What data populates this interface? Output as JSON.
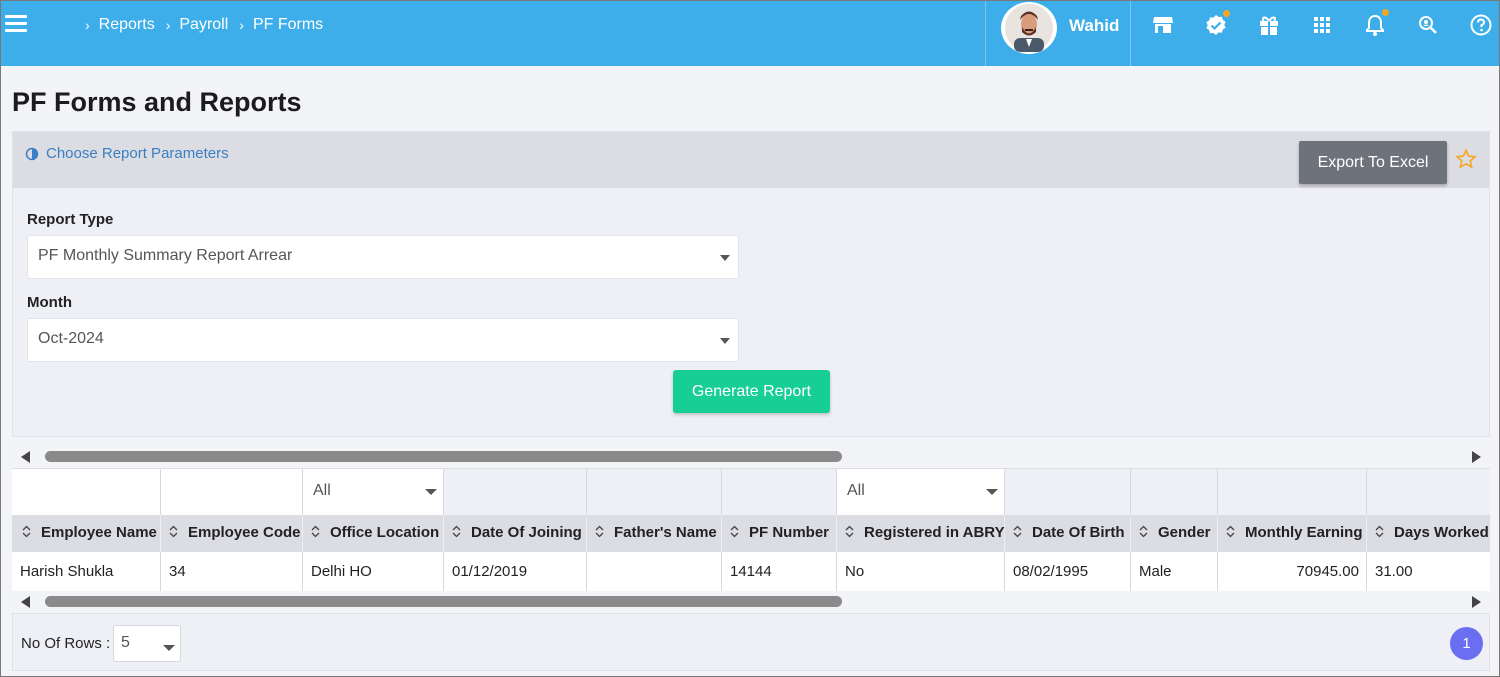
{
  "breadcrumb": {
    "items": [
      "Reports",
      "Payroll",
      "PF Forms"
    ]
  },
  "user": {
    "name": "Wahid"
  },
  "top_icons": [
    "store-icon",
    "verified-badge-icon",
    "gift-icon",
    "apps-grid-icon",
    "bell-icon",
    "search-user-icon",
    "help-icon"
  ],
  "page": {
    "title": "PF Forms and Reports"
  },
  "params": {
    "link_label": "Choose Report Parameters",
    "export_label": "Export To Excel",
    "report_type_label": "Report Type",
    "report_type_value": "PF Monthly Summary Report Arrear",
    "month_label": "Month",
    "month_value": "Oct-2024",
    "generate_label": "Generate Report"
  },
  "grid": {
    "filters": {
      "office_location": "All",
      "registered_in_abry": "All"
    },
    "columns": [
      "Employee Name",
      "Employee Code",
      "Office Location",
      "Date Of Joining",
      "Father's Name",
      "PF Number",
      "Registered in ABRY",
      "Date Of Birth",
      "Gender",
      "Monthly Earning",
      "Days Worked"
    ],
    "rows": [
      [
        "Harish Shukla",
        "34",
        "Delhi HO",
        "01/12/2019",
        "",
        "14144",
        "No",
        "08/02/1995",
        "Male",
        "70945.00",
        "31.00"
      ]
    ]
  },
  "footer": {
    "rows_label": "No Of Rows :",
    "rows_value": "5",
    "current_page": "1"
  },
  "colors": {
    "topbar": "#3daee9",
    "export_button": "#6e737b",
    "generate_button": "#17cf94",
    "page_bubble": "#6a6ef0",
    "star": "#f5a623"
  }
}
